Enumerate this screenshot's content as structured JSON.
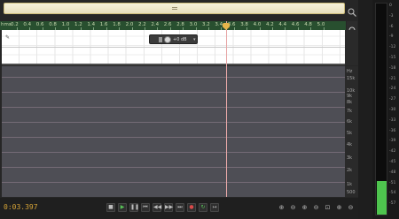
{
  "editor": {
    "ruler_start": "hms",
    "ruler_labels": [
      "0.2",
      "0.4",
      "0.6",
      "0.8",
      "1.0",
      "1.2",
      "1.4",
      "1.6",
      "1.8",
      "2.0",
      "2.2",
      "2.4",
      "2.6",
      "2.8",
      "3.0",
      "3.2",
      "3.4",
      "3.6",
      "3.8",
      "4.0",
      "4.2",
      "4.4",
      "4.6",
      "4.8",
      "5.0"
    ],
    "hud_value": "+0 dB",
    "spectral_scale": [
      "Hz",
      "15k",
      "10k",
      "9k",
      "8k",
      "7k",
      "6k",
      "5k",
      "4k",
      "3k",
      "2k",
      "1k",
      "500"
    ],
    "current_time": "0:03.397"
  },
  "icons": {
    "zoom_top": "zoom-icon",
    "headphone": "headphone-icon",
    "pencil": "pencil-icon"
  },
  "transport": {
    "buttons": [
      {
        "name": "stop-button",
        "glyph": "■"
      },
      {
        "name": "play-button",
        "glyph": "▶"
      },
      {
        "name": "pause-button",
        "glyph": "❚❚"
      },
      {
        "name": "goto-start-button",
        "glyph": "⏮"
      },
      {
        "name": "rewind-button",
        "glyph": "◀◀"
      },
      {
        "name": "fast-forward-button",
        "glyph": "▶▶"
      },
      {
        "name": "goto-end-button",
        "glyph": "⏭"
      },
      {
        "name": "record-button",
        "glyph": "●"
      },
      {
        "name": "loop-button",
        "glyph": "↻"
      },
      {
        "name": "skip-button",
        "glyph": "↦"
      }
    ],
    "zoom_buttons": [
      {
        "name": "zoom-in-amplitude-button",
        "glyph": "⊕"
      },
      {
        "name": "zoom-out-amplitude-button",
        "glyph": "⊖"
      },
      {
        "name": "zoom-in-time-button",
        "glyph": "⊕"
      },
      {
        "name": "zoom-out-time-button",
        "glyph": "⊖"
      },
      {
        "name": "zoom-full-button",
        "glyph": "⊡"
      },
      {
        "name": "zoom-selection-in-button",
        "glyph": "⊕"
      },
      {
        "name": "zoom-selection-out-button",
        "glyph": "⊖"
      }
    ]
  },
  "meter": {
    "scale": [
      "0",
      "-3",
      "-6",
      "-9",
      "-12",
      "-15",
      "-18",
      "-21",
      "-24",
      "-27",
      "-30",
      "-33",
      "-36",
      "-39",
      "-42",
      "-45",
      "-48",
      "-51",
      "-54",
      "-57"
    ],
    "level_fraction": 0.16,
    "colors": {
      "bar": "#4ec44e",
      "accent": "#d6a437"
    }
  }
}
